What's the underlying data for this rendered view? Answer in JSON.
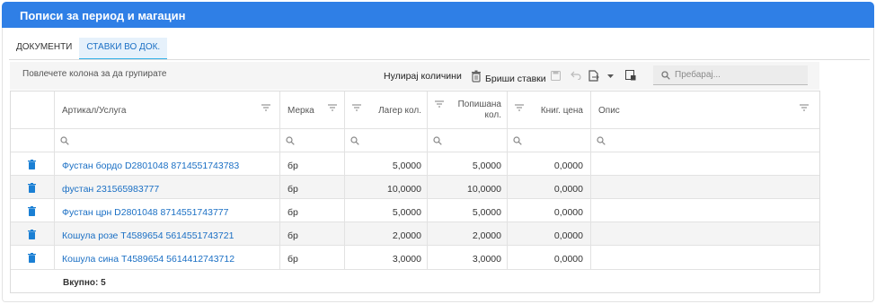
{
  "title": "Пописи за период и магацин",
  "tabs": [
    {
      "label": "ДОКУМЕНТИ",
      "active": false
    },
    {
      "label": "СТАВКИ ВО ДОК.",
      "active": true
    }
  ],
  "toolbar": {
    "group_hint": "Повлечете колона за да групирате",
    "reset_quantities": "Нулирај количини",
    "delete_items": "Бриши ставки",
    "search_placeholder": "Пребарај..."
  },
  "columns": {
    "article": "Артикал/Услуга",
    "unit": "Мерка",
    "stock_qty": "Лагер кол.",
    "counted_qty_line1": "Попишана",
    "counted_qty_line2": "кол.",
    "book_price": "Книг. цена",
    "description": "Опис"
  },
  "rows": [
    {
      "article": "Фустан бордо D2801048 8714551743783",
      "unit": "бр",
      "stock_qty": "5,0000",
      "counted_qty": "5,0000",
      "book_price": "0,0000",
      "description": ""
    },
    {
      "article": "фустан 231565983777",
      "unit": "бр",
      "stock_qty": "10,0000",
      "counted_qty": "10,0000",
      "book_price": "0,0000",
      "description": ""
    },
    {
      "article": "Фустан црн D2801048 8714551743777",
      "unit": "бр",
      "stock_qty": "5,0000",
      "counted_qty": "5,0000",
      "book_price": "0,0000",
      "description": ""
    },
    {
      "article": "Кошула розе T4589654 5614551743721",
      "unit": "бр",
      "stock_qty": "2,0000",
      "counted_qty": "2,0000",
      "book_price": "0,0000",
      "description": ""
    },
    {
      "article": "Кошула сина T4589654 5614412743712",
      "unit": "бр",
      "stock_qty": "3,0000",
      "counted_qty": "3,0000",
      "book_price": "0,0000",
      "description": ""
    }
  ],
  "footer": {
    "total": "Вкупно: 5"
  },
  "colors": {
    "header_blue": "#2f7fe6",
    "link": "#1a6fc4",
    "trash": "#1a7fd4"
  }
}
